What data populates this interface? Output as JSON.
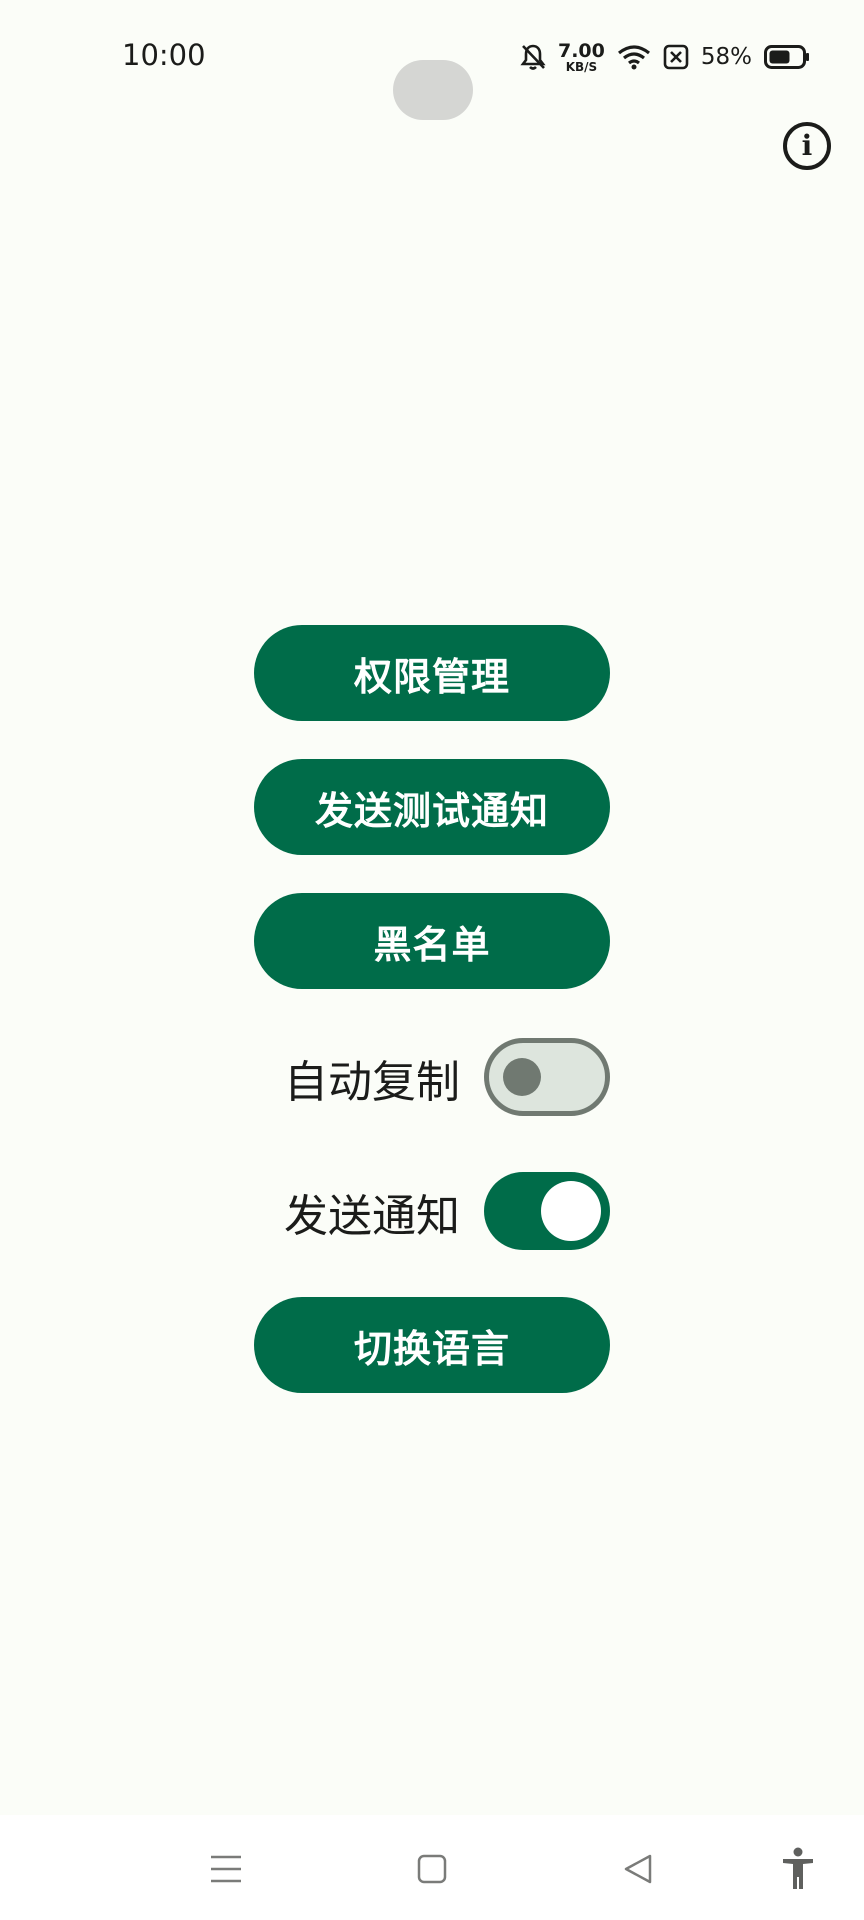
{
  "status_bar": {
    "time": "10:00",
    "net_speed_value": "7.00",
    "net_speed_unit": "KB/S",
    "battery_percent": "58%",
    "icons": [
      "bell-off-icon",
      "wifi-icon",
      "sim-off-icon",
      "battery-icon"
    ]
  },
  "header": {
    "info_glyph": "i",
    "info_icon": "info-icon"
  },
  "actions": {
    "permissions": "权限管理",
    "send_test_notification": "发送测试通知",
    "blacklist": "黑名单",
    "switch_language": "切换语言"
  },
  "toggles": {
    "auto_copy": {
      "label": "自动复制",
      "on": false
    },
    "send_notification": {
      "label": "发送通知",
      "on": true
    }
  },
  "nav_bar": {
    "icons": [
      "menu-icon",
      "home-icon",
      "back-icon",
      "accessibility-icon"
    ]
  },
  "colors": {
    "primary": "#006c49",
    "background": "#fbfdf8",
    "switch_off_track": "#dde5dd",
    "switch_off_outline": "#707971"
  }
}
